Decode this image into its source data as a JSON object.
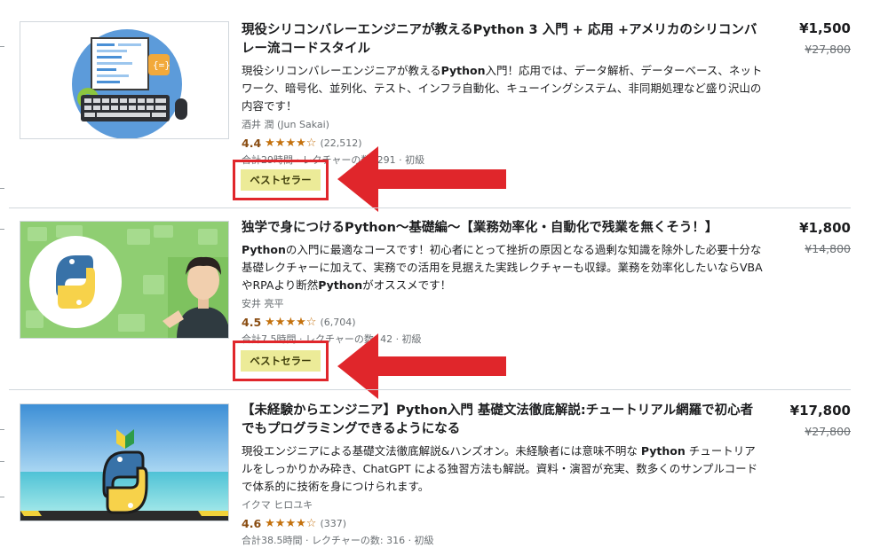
{
  "courses": [
    {
      "title": "現役シリコンバレーエンジニアが教えるPython 3 入門 + 応用 +アメリカのシリコンバレー流コードスタイル",
      "desc_prefix": "現役シリコンバレーエンジニアが教える",
      "desc_bold": "Python",
      "desc_rest": "入門！応用では、データ解析、データーベース、ネットワーク、暗号化、並列化、テスト、インフラ自動化、キューイングシステム、非同期処理など盛り沢山の内容です！",
      "author": "酒井 潤 (Jun Sakai)",
      "rating": "4.4",
      "stars": "★★★★☆",
      "reviews": "(22,512)",
      "meta": "合計29時間 · レクチャーの数: 291 · 初級",
      "badge": "ベストセラー",
      "price": "¥1,500",
      "original_price": "¥27,800"
    },
    {
      "title": "独学で身につけるPython〜基礎編〜【業務効率化・自動化で残業を無くそう！】",
      "desc_bold_1": "Python",
      "desc_mid": "の入門に最適なコースです！初心者にとって挫折の原因となる過剰な知識を除外した必要十分な基礎レクチャーに加えて、実務での活用を見据えた実践レクチャーも収録。業務を効率化したいならVBAやRPAより断然",
      "desc_bold_2": "Python",
      "desc_end": "がオススメです！",
      "author": "安井 亮平",
      "rating": "4.5",
      "stars": "★★★★☆",
      "reviews": "(6,704)",
      "meta": "合計7.5時間 · レクチャーの数: 42 · 初級",
      "badge": "ベストセラー",
      "price": "¥1,800",
      "original_price": "¥14,800"
    },
    {
      "title": "【未経験からエンジニア】Python入門 基礎文法徹底解説:チュートリアル網羅で初心者でもプログラミングできるようになる",
      "desc_prefix": "現役エンジニアによる基礎文法徹底解説&ハンズオン。未経験者には意味不明な ",
      "desc_bold": "Python",
      "desc_rest": " チュートリアルをしっかりかみ砕き、ChatGPT による独習方法も解説。資料・演習が充実、数多くのサンプルコードで体系的に技術を身につけられます。",
      "author": "イクマ ヒロユキ",
      "rating": "4.6",
      "stars": "★★★★☆",
      "reviews": "(337)",
      "meta": "合計38.5時間 · レクチャーの数: 316 · 初級",
      "price": "¥17,800",
      "original_price": "¥27,800"
    }
  ],
  "colors": {
    "highlight_red": "#e0262b",
    "badge_bg": "#eceb98",
    "star": "#c4710d",
    "rating": "#8a4d12"
  },
  "icons": [
    "python-logo-icon",
    "keyboard-icon",
    "mouse-icon",
    "gear-icon",
    "beginner-mark-icon",
    "arrow-left-icon"
  ]
}
